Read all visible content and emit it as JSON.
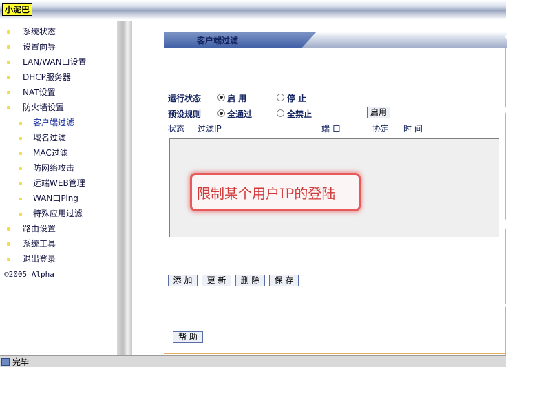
{
  "app": {
    "brand": "小泥巴"
  },
  "sidebar": {
    "items": [
      {
        "label": "系统状态"
      },
      {
        "label": "设置向导"
      },
      {
        "label": "LAN/WAN口设置"
      },
      {
        "label": "DHCP服务器"
      },
      {
        "label": "NAT设置"
      },
      {
        "label": "防火墙设置"
      },
      {
        "label": "客户端过滤"
      },
      {
        "label": "域名过滤"
      },
      {
        "label": "MAC过滤"
      },
      {
        "label": "防网络攻击"
      },
      {
        "label": "远端WEB管理"
      },
      {
        "label": "WAN口Ping"
      },
      {
        "label": "特殊应用过滤"
      },
      {
        "label": "路由设置"
      },
      {
        "label": "系统工具"
      },
      {
        "label": "退出登录"
      }
    ],
    "active_item": "客户端过滤",
    "copyright": "©2005 Alpha"
  },
  "panel": {
    "title": "客户端过滤",
    "run_status_label": "运行状态",
    "run_on": "启 用",
    "run_off": "停 止",
    "run_selected": "启 用",
    "default_rule_label": "预设规则",
    "rule_allow": "全通过",
    "rule_block": "全禁止",
    "rule_selected": "全通过",
    "enable_button": "启用",
    "columns": [
      "状态",
      "过滤IP",
      "端 口",
      "协定",
      "时 间"
    ],
    "annotation": "限制某个用户IP的登陆",
    "buttons": {
      "add": "添 加",
      "update": "更 新",
      "delete": "删 除",
      "save": "保 存",
      "help": "帮 助"
    }
  },
  "statusbar": {
    "text": "完毕"
  },
  "colors": {
    "accent": "#14245e",
    "annotation": "#d23a3a",
    "brand_bg": "#ffff33"
  }
}
